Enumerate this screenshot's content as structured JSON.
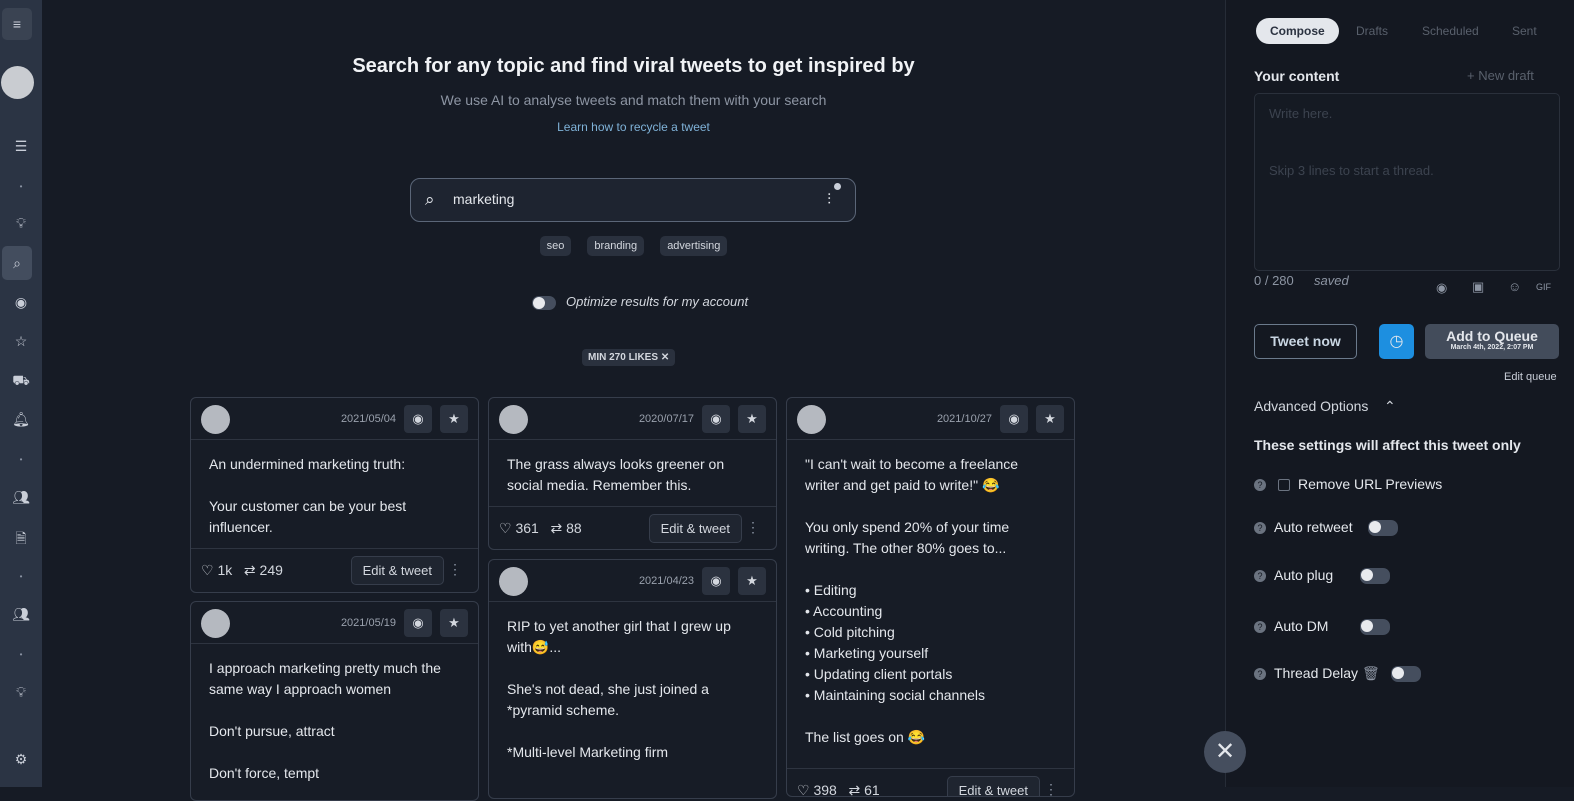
{
  "sidebar": {
    "icons": [
      "menu-icon",
      "avatar",
      "list-icon",
      "dot",
      "lightbulb-icon",
      "search-icon",
      "robot-icon",
      "star-icon",
      "car-icon",
      "bell-icon",
      "dot",
      "users-icon",
      "document-icon",
      "dot",
      "users-icon",
      "dot",
      "lightbulb-icon",
      "gear-icon"
    ],
    "active": "search-icon"
  },
  "main": {
    "title": "Search for any topic and find viral tweets to get inspired by",
    "subtitle": "We use AI to analyse tweets and match them with your search",
    "learn_link": "Learn how to recycle a tweet",
    "search": {
      "value": "marketing"
    },
    "suggestions": [
      "seo",
      "branding",
      "advertising"
    ],
    "optimize_label": "Optimize results for my account",
    "optimize_on": false,
    "filter_chip": "MIN 270 LIKES"
  },
  "cards": [
    {
      "date": "2021/05/04",
      "text": "An undermined marketing truth:\n\nYour customer can be your best influencer.",
      "likes": "1k",
      "retweets": "249",
      "edit": "Edit & tweet"
    },
    {
      "date": "2021/05/19",
      "text": "I approach marketing pretty much the same way I approach women\n\nDon't pursue, attract\n\nDon't force, tempt"
    },
    {
      "date": "2020/07/17",
      "text": "The grass always looks greener on social media. Remember this.",
      "likes": "361",
      "retweets": "88",
      "edit": "Edit & tweet"
    },
    {
      "date": "2021/04/23",
      "text": "RIP to yet another girl that I grew up with😅...\n\nShe's not dead, she just joined a *pyramid scheme.\n\n*Multi-level Marketing firm"
    },
    {
      "date": "2021/10/27",
      "text": "\"I can't wait to become a freelance writer and get paid to write!\" 😂\n\nYou only spend 20% of your time writing. The other 80% goes to...\n\n• Editing\n• Accounting\n• Cold pitching\n• Marketing yourself\n• Updating client portals\n• Maintaining social channels\n\nThe list goes on 😂",
      "likes": "398",
      "retweets": "61",
      "edit": "Edit & tweet"
    }
  ],
  "compose": {
    "tabs": [
      "Compose",
      "Drafts",
      "Scheduled",
      "Sent"
    ],
    "active_tab": "Compose",
    "your_content": "Your content",
    "new_draft": "+ New draft",
    "placeholder": "Write here.\n\n\nSkip 3 lines to start a thread.",
    "counter": "0 / 280",
    "saved": "saved",
    "gif": "GIF",
    "tweet_now": "Tweet now",
    "add_queue": "Add to Queue",
    "queue_time": "March 4th, 2022, 2:07 PM",
    "edit_queue": "Edit queue",
    "advanced": "Advanced Options",
    "settings_note": "These settings will affect this tweet only",
    "options": [
      {
        "label": "Remove URL Previews",
        "type": "checkbox"
      },
      {
        "label": "Auto retweet",
        "type": "toggle"
      },
      {
        "label": "Auto plug",
        "type": "toggle"
      },
      {
        "label": "Auto DM",
        "type": "toggle"
      },
      {
        "label": "Thread Delay",
        "type": "toggle"
      }
    ],
    "accent": "#1d8fe0"
  }
}
